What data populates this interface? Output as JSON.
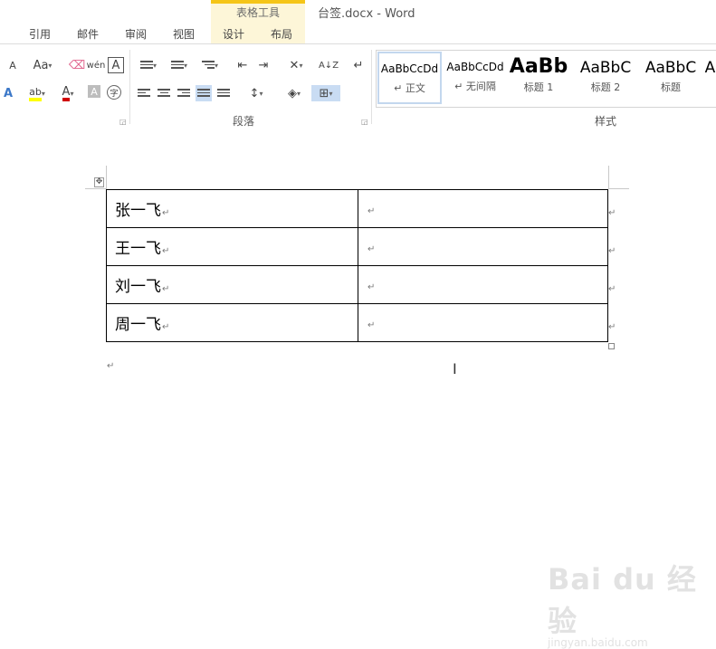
{
  "window": {
    "title": "台签.docx - Word",
    "context_group": "表格工具"
  },
  "tabs": [
    "引用",
    "邮件",
    "审阅",
    "视图"
  ],
  "context_tabs": [
    "设计",
    "布局"
  ],
  "ribbon": {
    "font_group": {
      "shrink_label": "A",
      "case_label": "Aa",
      "phonetic_label": "wén",
      "border_char_label": "A",
      "effects_label": "A",
      "highlight_label": "ab",
      "font_color_label": "A",
      "shading_label": "A",
      "enclose_label": "字",
      "highlight_color": "#ffff00",
      "font_color": "#d00000"
    },
    "paragraph_group": {
      "label": "段落",
      "sort_label": "A↓Z"
    },
    "styles_group": {
      "label": "样式",
      "styles": [
        {
          "sample": "AaBbCcDd",
          "name": "↵ 正文"
        },
        {
          "sample": "AaBbCcDd",
          "name": "↵ 无间隔"
        },
        {
          "sample": "AaBb",
          "name": "标题 1"
        },
        {
          "sample": "AaBbC",
          "name": "标题 2"
        },
        {
          "sample": "AaBbC",
          "name": "标题"
        },
        {
          "sample": "A",
          "name": ""
        }
      ]
    }
  },
  "document": {
    "table": {
      "rows": [
        {
          "name": "张一飞",
          "mark": "↵",
          "empty_mark": "↵"
        },
        {
          "name": "王一飞",
          "mark": "↵",
          "empty_mark": "↵"
        },
        {
          "name": "刘一飞",
          "mark": "↵",
          "empty_mark": "↵"
        },
        {
          "name": "周一飞",
          "mark": "↵",
          "empty_mark": "↵"
        }
      ],
      "row_end_mark": "↵",
      "move_handle": "✥"
    },
    "after_table_mark": "↵"
  },
  "watermark": {
    "brand": "Bai du 经验",
    "url": "jingyan.baidu.com"
  }
}
